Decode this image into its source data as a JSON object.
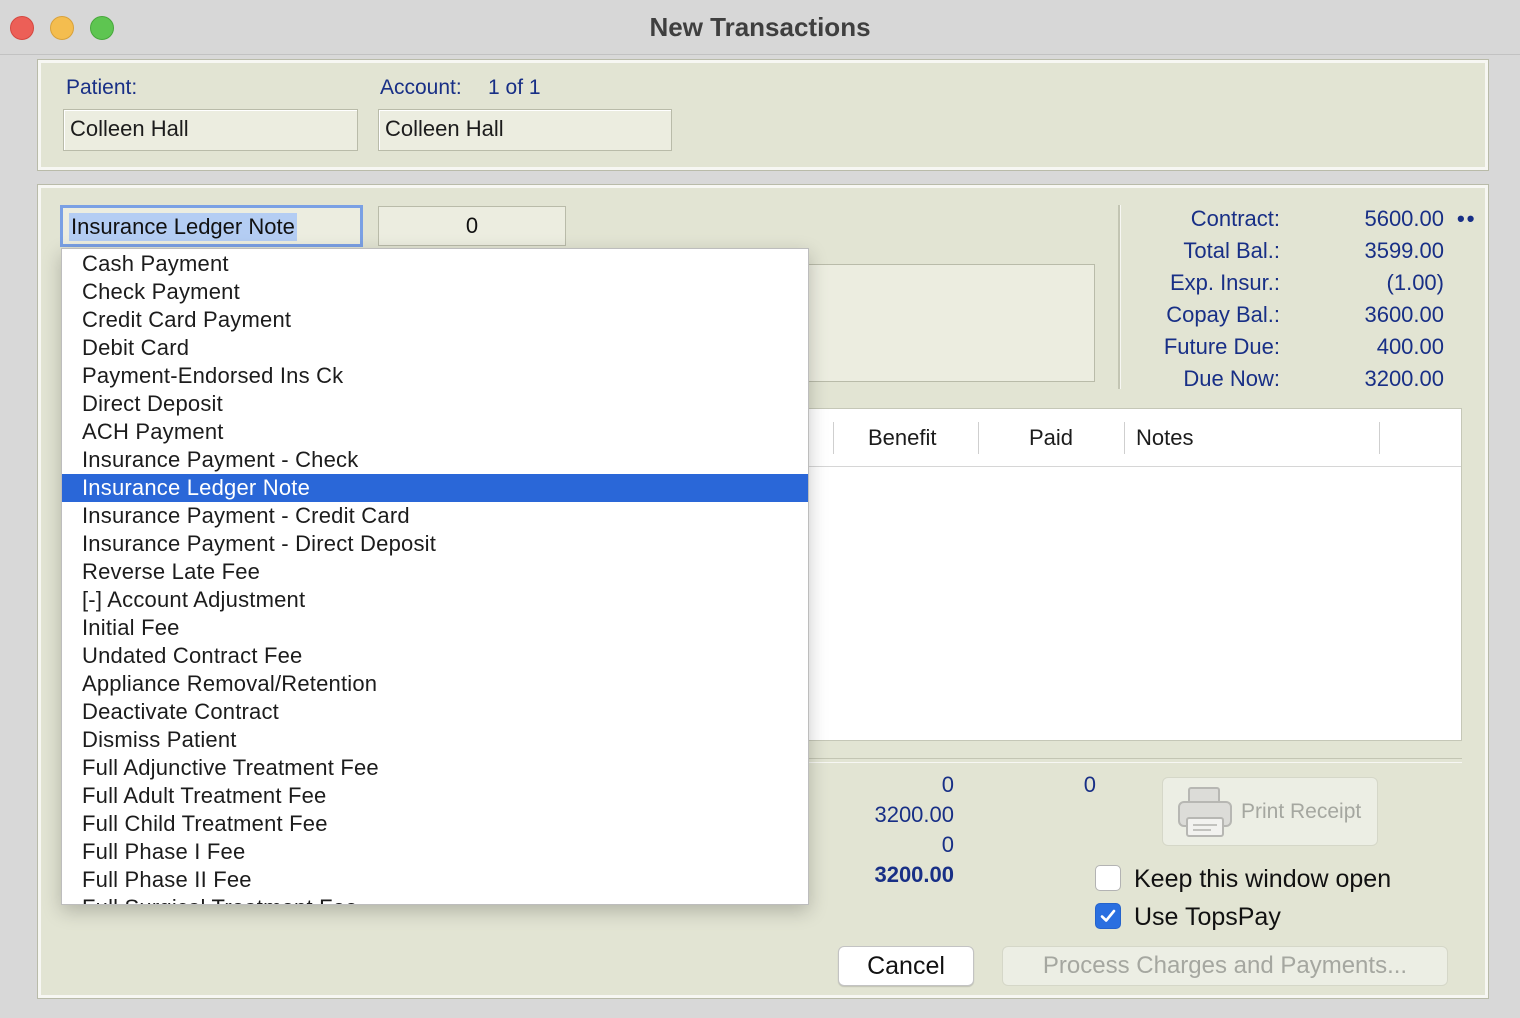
{
  "window": {
    "title": "New Transactions"
  },
  "patient_section": {
    "patient_label": "Patient:",
    "patient_value": "Colleen Hall",
    "account_label": "Account:",
    "account_position": "1 of 1",
    "account_value": "Colleen Hall"
  },
  "transaction": {
    "type_value": "Insurance Ledger Note",
    "amount_value": "0"
  },
  "summary": [
    {
      "label": "Contract:",
      "value": "5600.00"
    },
    {
      "label": "Total Bal.:",
      "value": "3599.00"
    },
    {
      "label": "Exp. Insur.:",
      "value": "(1.00)"
    },
    {
      "label": "Copay Bal.:",
      "value": "3600.00"
    },
    {
      "label": "Future Due:",
      "value": "400.00"
    },
    {
      "label": "Due Now:",
      "value": "3200.00"
    }
  ],
  "summary_more": "••",
  "table": {
    "columns": [
      "Benefit",
      "Paid",
      "Notes"
    ]
  },
  "totals": {
    "col1": [
      "0",
      "3200.00",
      "0",
      "3200.00"
    ],
    "col2": [
      "0"
    ]
  },
  "print_button": {
    "label": "Print Receipt"
  },
  "checkboxes": [
    {
      "label": "Keep this window open",
      "checked": false
    },
    {
      "label": "Use TopsPay",
      "checked": true
    }
  ],
  "buttons": {
    "cancel": "Cancel",
    "process": "Process Charges and Payments..."
  },
  "dropdown": {
    "selected_index": 8,
    "items": [
      "Cash Payment",
      "Check Payment",
      "Credit Card Payment",
      "Debit Card",
      "Payment-Endorsed Ins Ck",
      "Direct Deposit",
      "ACH Payment",
      "Insurance Payment - Check",
      "Insurance Ledger Note",
      "Insurance Payment - Credit Card",
      "Insurance Payment - Direct Deposit",
      "Reverse Late Fee",
      "[-] Account Adjustment",
      "Initial Fee",
      "Undated Contract Fee",
      "Appliance Removal/Retention",
      "Deactivate Contract",
      "Dismiss Patient",
      "Full Adjunctive Treatment Fee",
      "Full Adult Treatment Fee",
      "Full Child Treatment Fee",
      "Full Phase I Fee",
      "Full Phase II Fee",
      "Full Surgical Treatment Fee"
    ]
  },
  "colors": {
    "label_blue": "#182f86",
    "panel_bg": "#e2e4d3",
    "selection_blue": "#2a67d8",
    "close": "#ec5f57",
    "minimize": "#f4bd4f",
    "zoom": "#5ec551"
  }
}
